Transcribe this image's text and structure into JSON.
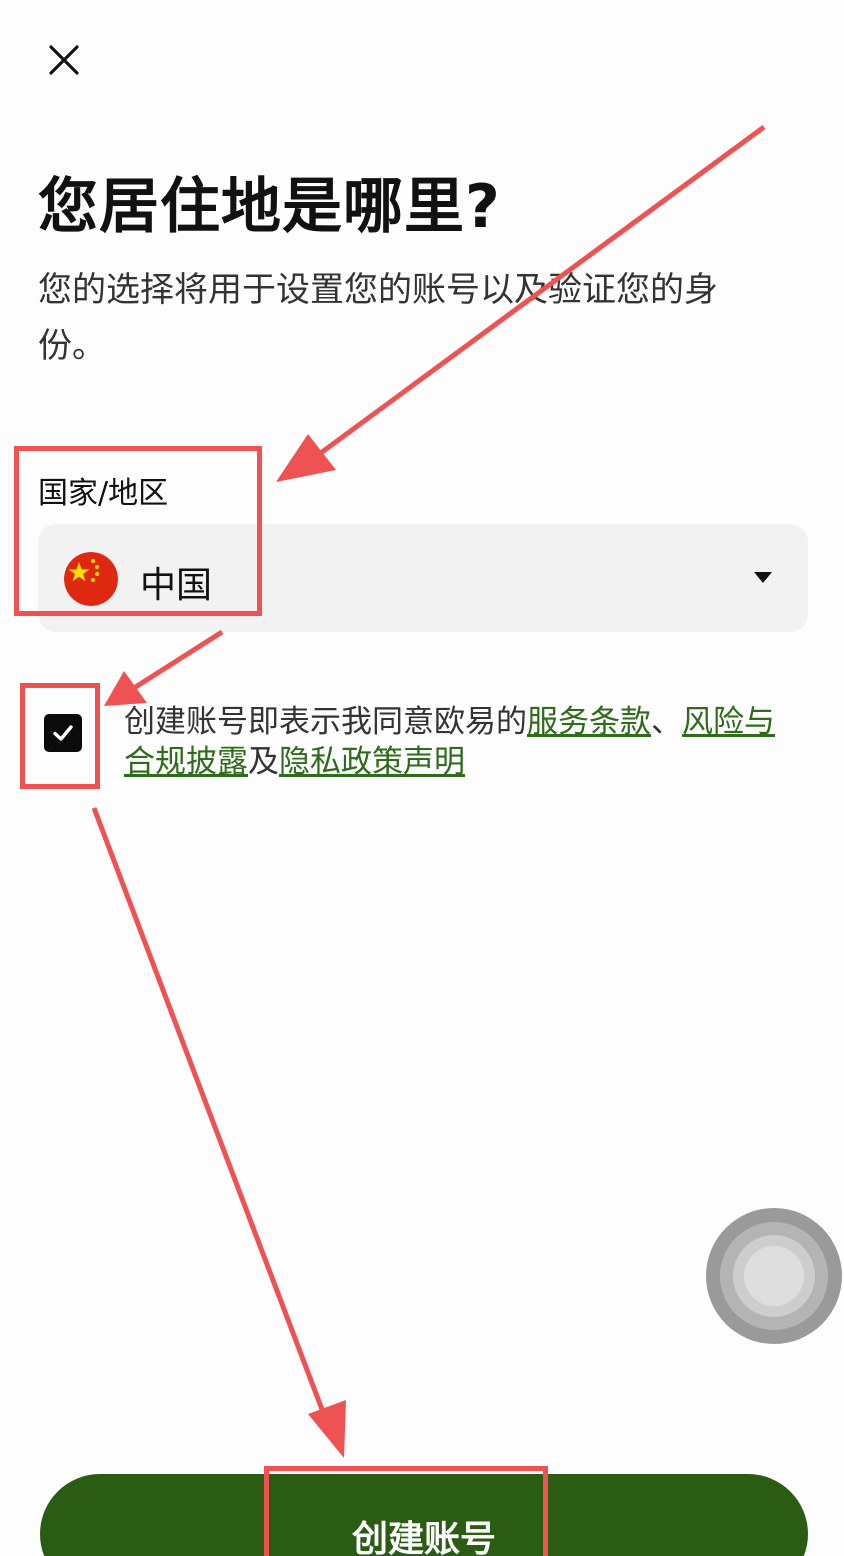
{
  "header": {
    "close_icon": "close-icon"
  },
  "main": {
    "title": "您居住地是哪里?",
    "subtitle": "您的选择将用于设置您的账号以及验证您的身份。"
  },
  "country_field": {
    "label": "国家/地区",
    "value": "中国",
    "flag_icon": "china-flag-icon",
    "dropdown_icon": "caret-down-icon"
  },
  "agreement": {
    "checked": true,
    "prefix": "创建账号即表示我同意欧易的",
    "link_terms": "服务条款",
    "sep1": "、",
    "link_risk": "风险与合规披露",
    "and": "及",
    "link_privacy": "隐私政策声明"
  },
  "primary_button": {
    "label": "创建账号"
  },
  "colors": {
    "brand_green": "#2a5c14",
    "link_green": "#2e6b1a",
    "annotation_red": "#ee5252",
    "field_bg": "#f2f2f3"
  }
}
